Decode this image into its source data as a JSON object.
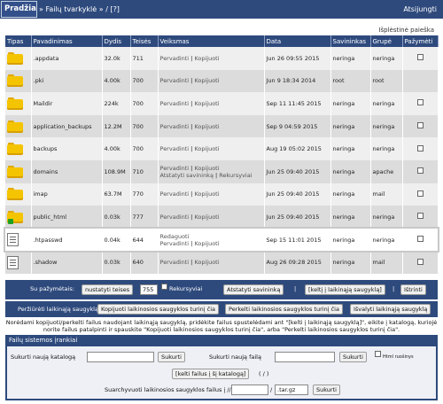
{
  "topbar": {
    "home": "Pradžia",
    "sep1": "»",
    "crumb_manager": "Failų tvarkyklė",
    "sep2": "»",
    "crumb_tail": "/ [?]",
    "logout": "Atsijungti"
  },
  "advanced_search": "Išplėstinė paieška",
  "table": {
    "headers": [
      "Tipas",
      "Pavadinimas",
      "Dydis",
      "Teisės",
      "Veiksmas",
      "Data",
      "Savininkas",
      "Grupė",
      "Pažymėti"
    ],
    "rows": [
      {
        "type": "folder",
        "name": ".appdata",
        "size": "32.0k",
        "perm": "711",
        "actions": [
          "Pervadinti",
          "Kopijuoti"
        ],
        "date": "Jun 26 09:55 2015",
        "owner": "neringa",
        "group": "neringa",
        "checkbox": true
      },
      {
        "type": "folder",
        "name": ".pki",
        "size": "4.00k",
        "perm": "700",
        "actions": [
          "Pervadinti",
          "Kopijuoti"
        ],
        "date": "Jun 9 18:34 2014",
        "owner": "root",
        "group": "root",
        "checkbox": false
      },
      {
        "type": "folder",
        "name": "Maildir",
        "size": "224k",
        "perm": "700",
        "actions": [
          "Pervadinti",
          "Kopijuoti"
        ],
        "date": "Sep 11 11:45 2015",
        "owner": "neringa",
        "group": "neringa",
        "checkbox": true
      },
      {
        "type": "folder",
        "name": "application_backups",
        "size": "12.2M",
        "perm": "700",
        "actions": [
          "Pervadinti",
          "Kopijuoti"
        ],
        "date": "Sep 9 04:59 2015",
        "owner": "neringa",
        "group": "neringa",
        "checkbox": true
      },
      {
        "type": "folder",
        "name": "backups",
        "size": "4.00k",
        "perm": "700",
        "actions": [
          "Pervadinti",
          "Kopijuoti"
        ],
        "date": "Aug 19 05:02 2015",
        "owner": "neringa",
        "group": "neringa",
        "checkbox": true
      },
      {
        "type": "folder",
        "name": "domains",
        "size": "108.9M",
        "perm": "710",
        "actions": [
          "Pervadinti",
          "Kopijuoti"
        ],
        "actions2": [
          "Atstatyti savininką",
          "Rekursyviai"
        ],
        "date": "Jun 25 09:40 2015",
        "owner": "neringa",
        "group": "apache",
        "checkbox": true
      },
      {
        "type": "folder",
        "name": "imap",
        "size": "63.7M",
        "perm": "770",
        "actions": [
          "Pervadinti",
          "Kopijuoti"
        ],
        "date": "Jun 25 09:40 2015",
        "owner": "neringa",
        "group": "mail",
        "checkbox": true
      },
      {
        "type": "folder-link",
        "name": "public_html",
        "size": "0.03k",
        "perm": "777",
        "actions": [
          "Pervadinti",
          "Kopijuoti"
        ],
        "date": "Jun 25 09:40 2015",
        "owner": "neringa",
        "group": "neringa",
        "checkbox": true
      },
      {
        "type": "file",
        "name": ".htpasswd",
        "size": "0.04k",
        "perm": "644",
        "actions": [
          "Redaguoti"
        ],
        "actions2": [
          "Pervadinti",
          "Kopijuoti"
        ],
        "date": "Sep 15 11:01 2015",
        "owner": "neringa",
        "group": "neringa",
        "checkbox": true
      },
      {
        "type": "file",
        "name": ".shadow",
        "size": "0.03k",
        "perm": "640",
        "actions": [
          "Pervadinti",
          "Kopijuoti"
        ],
        "date": "Aug 26 09:28 2015",
        "owner": "neringa",
        "group": "mail",
        "checkbox": true
      }
    ]
  },
  "selected_bar": {
    "label": "Su pažymėtais:",
    "set_perm": "nustatyti teises",
    "perm_value": "755",
    "recursive": "Rekursyviai",
    "reset_owner": "Atstatyti savininką",
    "add_clipboard": "[keltį į laikinąją saugyklą]",
    "delete": "Ištrinti"
  },
  "clipboard_bar": {
    "view": "Peržiūrėti laikinąją saugyklą",
    "copy": "Kopijuoti laikinosios saugyklos turinį čia",
    "move": "Perkelti laikinosios saugyklos turinį čia",
    "clear": "Išvalyti laikinąją saugyklą"
  },
  "notice": "Norėdami kopijuoti/perkelti failus naudojant laikinąją saugyklą, pridėkite failus spustelėdami ant \"[kelti į laikinąją saugyklą]\", eikite į katalogą, kuriojė norite failus patalpinti ir spauskite \"Kopijuoti laikinosios saugyklos turinį čia\", arba \"Perkelti laikinosios saugyklos turinį čia\".",
  "tools": {
    "title": "Failų sistemos įrankiai",
    "new_dir_label": "Sukurti naują katalogą",
    "new_dir_button": "Sukurti",
    "new_file_label": "Sukurti naują failą",
    "new_file_button": "Sukurti",
    "html_template": "Html ruošinys",
    "upload": "[kelti failus į šį katalogą]",
    "upload_tail": "( / )",
    "archive_label": "Suarchyvuoti laikinosios saugyklos failus į //",
    "archive_ext": ".tar.gz",
    "archive_button": "Sukurti"
  },
  "colors": {
    "bar": "#2e4a7d",
    "folder": "#f5c400"
  }
}
